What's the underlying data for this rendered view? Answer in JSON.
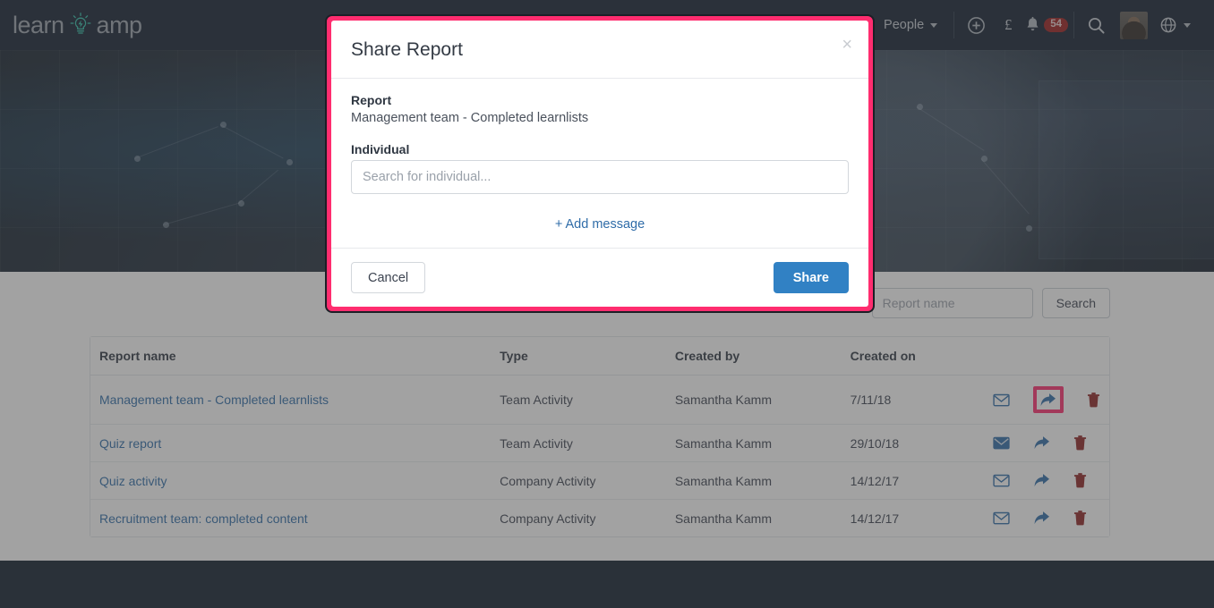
{
  "brand": {
    "text_left": "learn",
    "text_right": "amp",
    "icon": "lightbulb-icon",
    "color": "#9aa3ad",
    "accent": "#2fbfa8"
  },
  "topnav": {
    "background": "#111d2e",
    "people_label": "People",
    "icons": [
      {
        "name": "add-icon",
        "glyph": "+"
      },
      {
        "name": "currency-pound-icon",
        "glyph": "£"
      },
      {
        "name": "bell-icon",
        "glyph": "bell"
      },
      {
        "name": "search-icon",
        "glyph": "search"
      },
      {
        "name": "globe-icon",
        "glyph": "globe"
      }
    ],
    "notification_count": "54",
    "notification_badge_color": "#9b1b1b",
    "avatar": "user-avatar"
  },
  "search": {
    "placeholder": "Report name",
    "value": "",
    "button_label": "Search"
  },
  "table": {
    "columns": [
      "Report name",
      "Type",
      "Created by",
      "Created on",
      ""
    ],
    "rows": [
      {
        "name": "Management team - Completed learnlists",
        "type": "Team Activity",
        "created_by": "Samantha Kamm",
        "created_on": "7/11/18",
        "email_state": "outline",
        "share_highlighted": true
      },
      {
        "name": "Quiz report",
        "type": "Team Activity",
        "created_by": "Samantha Kamm",
        "created_on": "29/10/18",
        "email_state": "filled",
        "share_highlighted": false
      },
      {
        "name": "Quiz activity",
        "type": "Company Activity",
        "created_by": "Samantha Kamm",
        "created_on": "14/12/17",
        "email_state": "outline",
        "share_highlighted": false
      },
      {
        "name": "Recruitment team: completed content",
        "type": "Company Activity",
        "created_by": "Samantha Kamm",
        "created_on": "14/12/17",
        "email_state": "outline",
        "share_highlighted": false
      }
    ],
    "action_icons": [
      "email-icon",
      "share-icon",
      "delete-icon"
    ],
    "link_color": "#2f6ca8",
    "delete_color": "#8e2222"
  },
  "modal": {
    "title": "Share Report",
    "close_glyph": "×",
    "report_label": "Report",
    "report_value": "Management team - Completed learnlists",
    "individual_label": "Individual",
    "individual_placeholder": "Search for individual...",
    "individual_value": "",
    "add_message_label": "+ Add message",
    "cancel_label": "Cancel",
    "share_label": "Share",
    "share_button_color": "#3181c4",
    "highlight_border_color": "#ff2d6f"
  },
  "highlight": {
    "color": "#ff2d6f",
    "target": "share-icon-row-1"
  },
  "footer": {
    "background": "#0e1c2b"
  }
}
